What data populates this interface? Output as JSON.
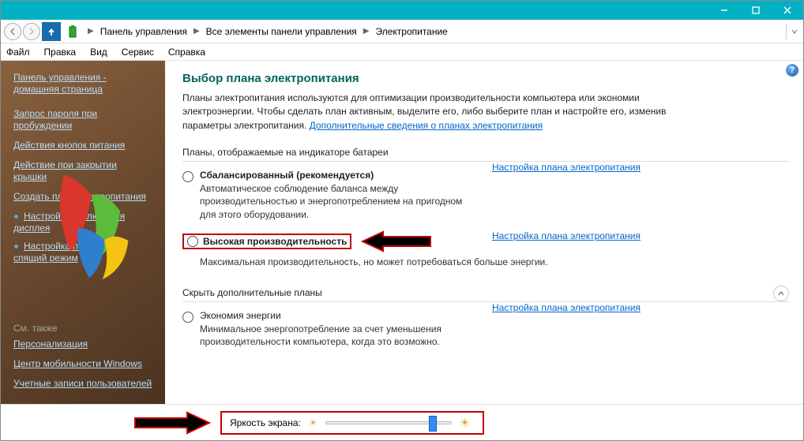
{
  "window": {
    "min": "—",
    "max": "☐",
    "close": "✕"
  },
  "breadcrumb": {
    "items": [
      "Панель управления",
      "Все элементы панели управления",
      "Электропитание"
    ]
  },
  "menu": {
    "items": [
      "Файл",
      "Правка",
      "Вид",
      "Сервис",
      "Справка"
    ]
  },
  "sidebar": {
    "home": "Панель управления - домашняя страница",
    "links": [
      "Запрос пароля при пробуждении",
      "Действия кнопок питания",
      "Действие при закрытии крышки",
      "Создать план электропитания",
      "Настройка отключения дисплея",
      "Настройка перехода в спящий режим"
    ],
    "see_also_head": "См. также",
    "see_also": [
      "Персонализация",
      "Центр мобильности Windows",
      "Учетные записи пользователей"
    ]
  },
  "main": {
    "title": "Выбор плана электропитания",
    "intro_1": "Планы электропитания используются для оптимизации производительности компьютера или экономии электроэнергии. Чтобы сделать план активным, выделите его, либо выберите план и настройте его, изменив параметры электропитания. ",
    "intro_link": "Дополнительные сведения о планах электропитания",
    "section1": "Планы, отображаемые на индикаторе батареи",
    "section2": "Скрыть дополнительные планы",
    "config_link": "Настройка плана электропитания",
    "plans": [
      {
        "name": "Сбалансированный (рекомендуется)",
        "desc": "Автоматическое соблюдение баланса между производительностью и энергопотреблением на пригодном для этого оборудовании.",
        "selected": false,
        "bold": true
      },
      {
        "name": "Высокая производительность",
        "desc": "Максимальная производительность, но может потребоваться больше энергии.",
        "selected": true,
        "bold": true
      },
      {
        "name": "Экономия энергии",
        "desc": "Минимальное энергопотребление за счет уменьшения производительности компьютера, когда это возможно.",
        "selected": false,
        "bold": false
      }
    ]
  },
  "bottom": {
    "brightness_label": "Яркость экрана:"
  }
}
